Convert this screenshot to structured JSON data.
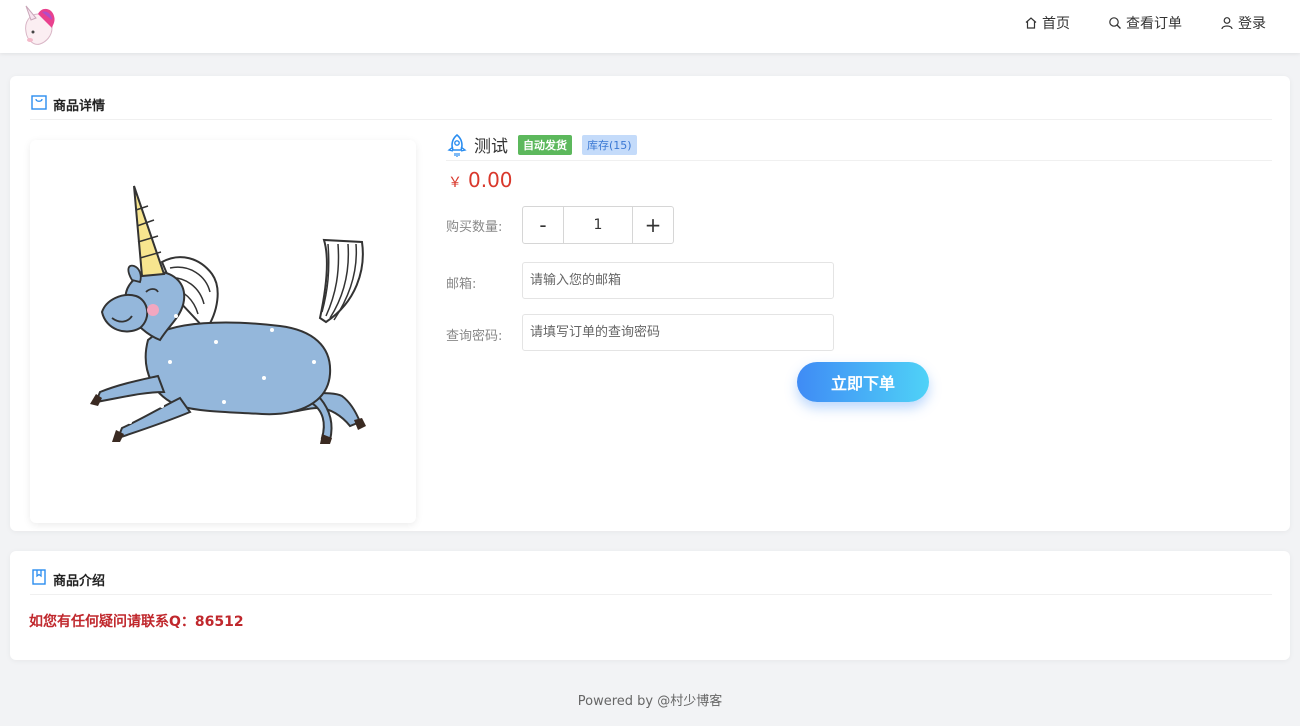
{
  "nav": {
    "items": [
      {
        "label": "首页",
        "icon": "home-icon"
      },
      {
        "label": "查看订单",
        "icon": "search-icon"
      },
      {
        "label": "登录",
        "icon": "user-icon"
      }
    ]
  },
  "detail": {
    "section_title": "商品详情",
    "product_name": "测试",
    "badge_auto": "自动发货",
    "badge_stock": "库存(15)",
    "currency": "￥",
    "price": "0.00",
    "quantity_label": "购买数量:",
    "quantity_minus": "-",
    "quantity_value": "1",
    "quantity_plus": "+",
    "email_label": "邮箱:",
    "email_placeholder": "请输入您的邮箱",
    "password_label": "查询密码:",
    "password_placeholder": "请填写订单的查询密码",
    "order_button": "立即下单"
  },
  "intro": {
    "section_title": "商品介绍",
    "text": "如您有任何疑问请联系Q：86512"
  },
  "footer": {
    "text": "Powered by @村少博客"
  },
  "colors": {
    "price": "#d9372b",
    "badge_green": "#5cb85c",
    "badge_blue_bg": "#c4dbfa",
    "intro_text": "#c0282d",
    "button_start": "#3f8bf5",
    "button_end": "#4fd2f7"
  }
}
